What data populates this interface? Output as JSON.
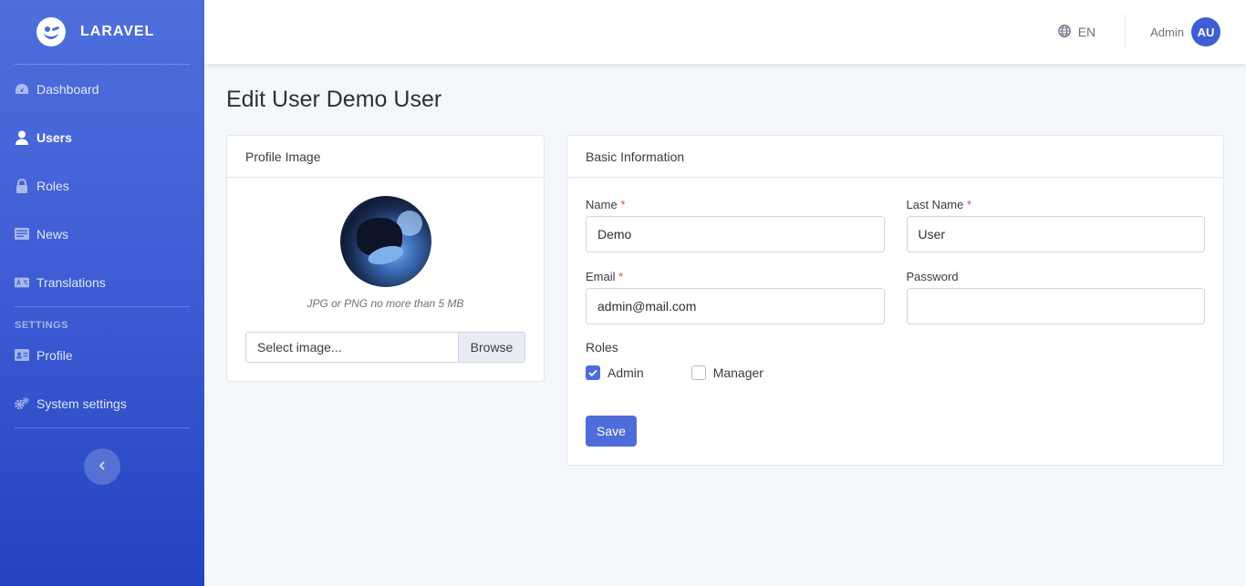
{
  "brand": {
    "name": "LARAVEL",
    "logo_icon": "laravel-smile-logo"
  },
  "sidebar": {
    "items": [
      {
        "label": "Dashboard",
        "icon": "tachometer-icon",
        "active": false
      },
      {
        "label": "Users",
        "icon": "user-icon",
        "active": true
      },
      {
        "label": "Roles",
        "icon": "lock-icon",
        "active": false
      },
      {
        "label": "News",
        "icon": "newspaper-icon",
        "active": false
      },
      {
        "label": "Translations",
        "icon": "language-icon",
        "active": false
      }
    ],
    "settings_section": "SETTINGS",
    "settings_items": [
      {
        "label": "Profile",
        "icon": "id-card-icon"
      },
      {
        "label": "System settings",
        "icon": "cogs-icon"
      }
    ],
    "toggle_icon": "chevron-left-icon"
  },
  "topbar": {
    "language": "EN",
    "language_icon": "globe-icon",
    "user_name": "Admin",
    "user_initials": "AU"
  },
  "page": {
    "title": "Edit User Demo User"
  },
  "profile_card": {
    "header": "Profile Image",
    "hint": "JPG or PNG no more than 5 MB",
    "file_label": "Select image...",
    "browse_label": "Browse"
  },
  "basic_card": {
    "header": "Basic Information",
    "fields": {
      "name": {
        "label": "Name",
        "value": "Demo",
        "required": "*"
      },
      "last_name": {
        "label": "Last Name",
        "value": "User",
        "required": "*"
      },
      "email": {
        "label": "Email",
        "value": "admin@mail.com",
        "required": "*"
      },
      "password": {
        "label": "Password",
        "value": ""
      }
    },
    "roles_label": "Roles",
    "roles": [
      {
        "label": "Admin",
        "checked": true
      },
      {
        "label": "Manager",
        "checked": false
      }
    ],
    "save_label": "Save"
  },
  "colors": {
    "primary": "#4e6ddb",
    "sidebar_top": "#4f6fdc",
    "sidebar_bottom": "#2343c0",
    "required": "#e74a3b"
  }
}
